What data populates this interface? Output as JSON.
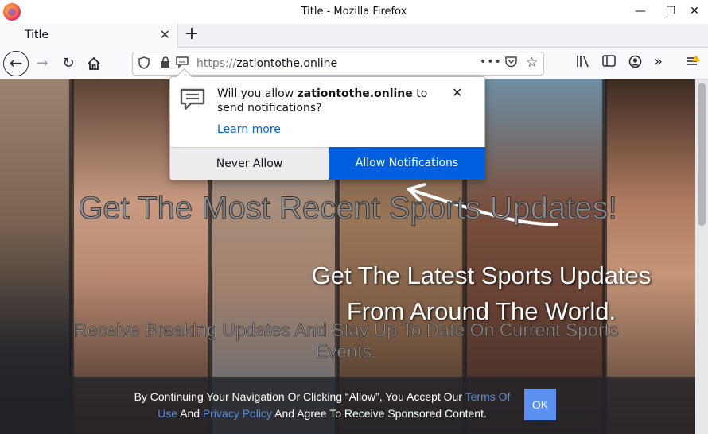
{
  "window": {
    "title": "Title - Mozilla Firefox",
    "minimize": "—",
    "maximize": "☐",
    "close": "✕"
  },
  "tabs": [
    {
      "label": "Title",
      "close": "✕"
    }
  ],
  "newtab": "+",
  "nav": {
    "url_protocol": "https://",
    "url_host": "zationtothe.online",
    "more": "•••"
  },
  "popup": {
    "line_pre": "Will you allow ",
    "site": "zationtothe.online",
    "line_post": " to send notifications?",
    "learn_more": "Learn more",
    "never_allow": "Never Allow",
    "allow": "Allow Notifications",
    "close": "✕"
  },
  "page": {
    "headline": "Get The Most Recent Sports Updates!",
    "subheadline_1": "Get The Latest Sports Updates",
    "subheadline_2": "From Around The World.",
    "description": "Receive Breaking Updates And Stay Up To Date On Current Sports Events.",
    "cookie": {
      "text_1": "By Continuing Your Navigation Or Clicking “Allow”, You Accept Our ",
      "link_terms": "Terms Of Use",
      "text_2": " And ",
      "link_privacy": "Privacy Policy",
      "text_3": " And Agree To Receive Sponsored Content.",
      "ok": "OK"
    }
  },
  "colors": {
    "accent": "#0060df",
    "link": "#0061e0",
    "ok_button": "#5b8ff0"
  }
}
